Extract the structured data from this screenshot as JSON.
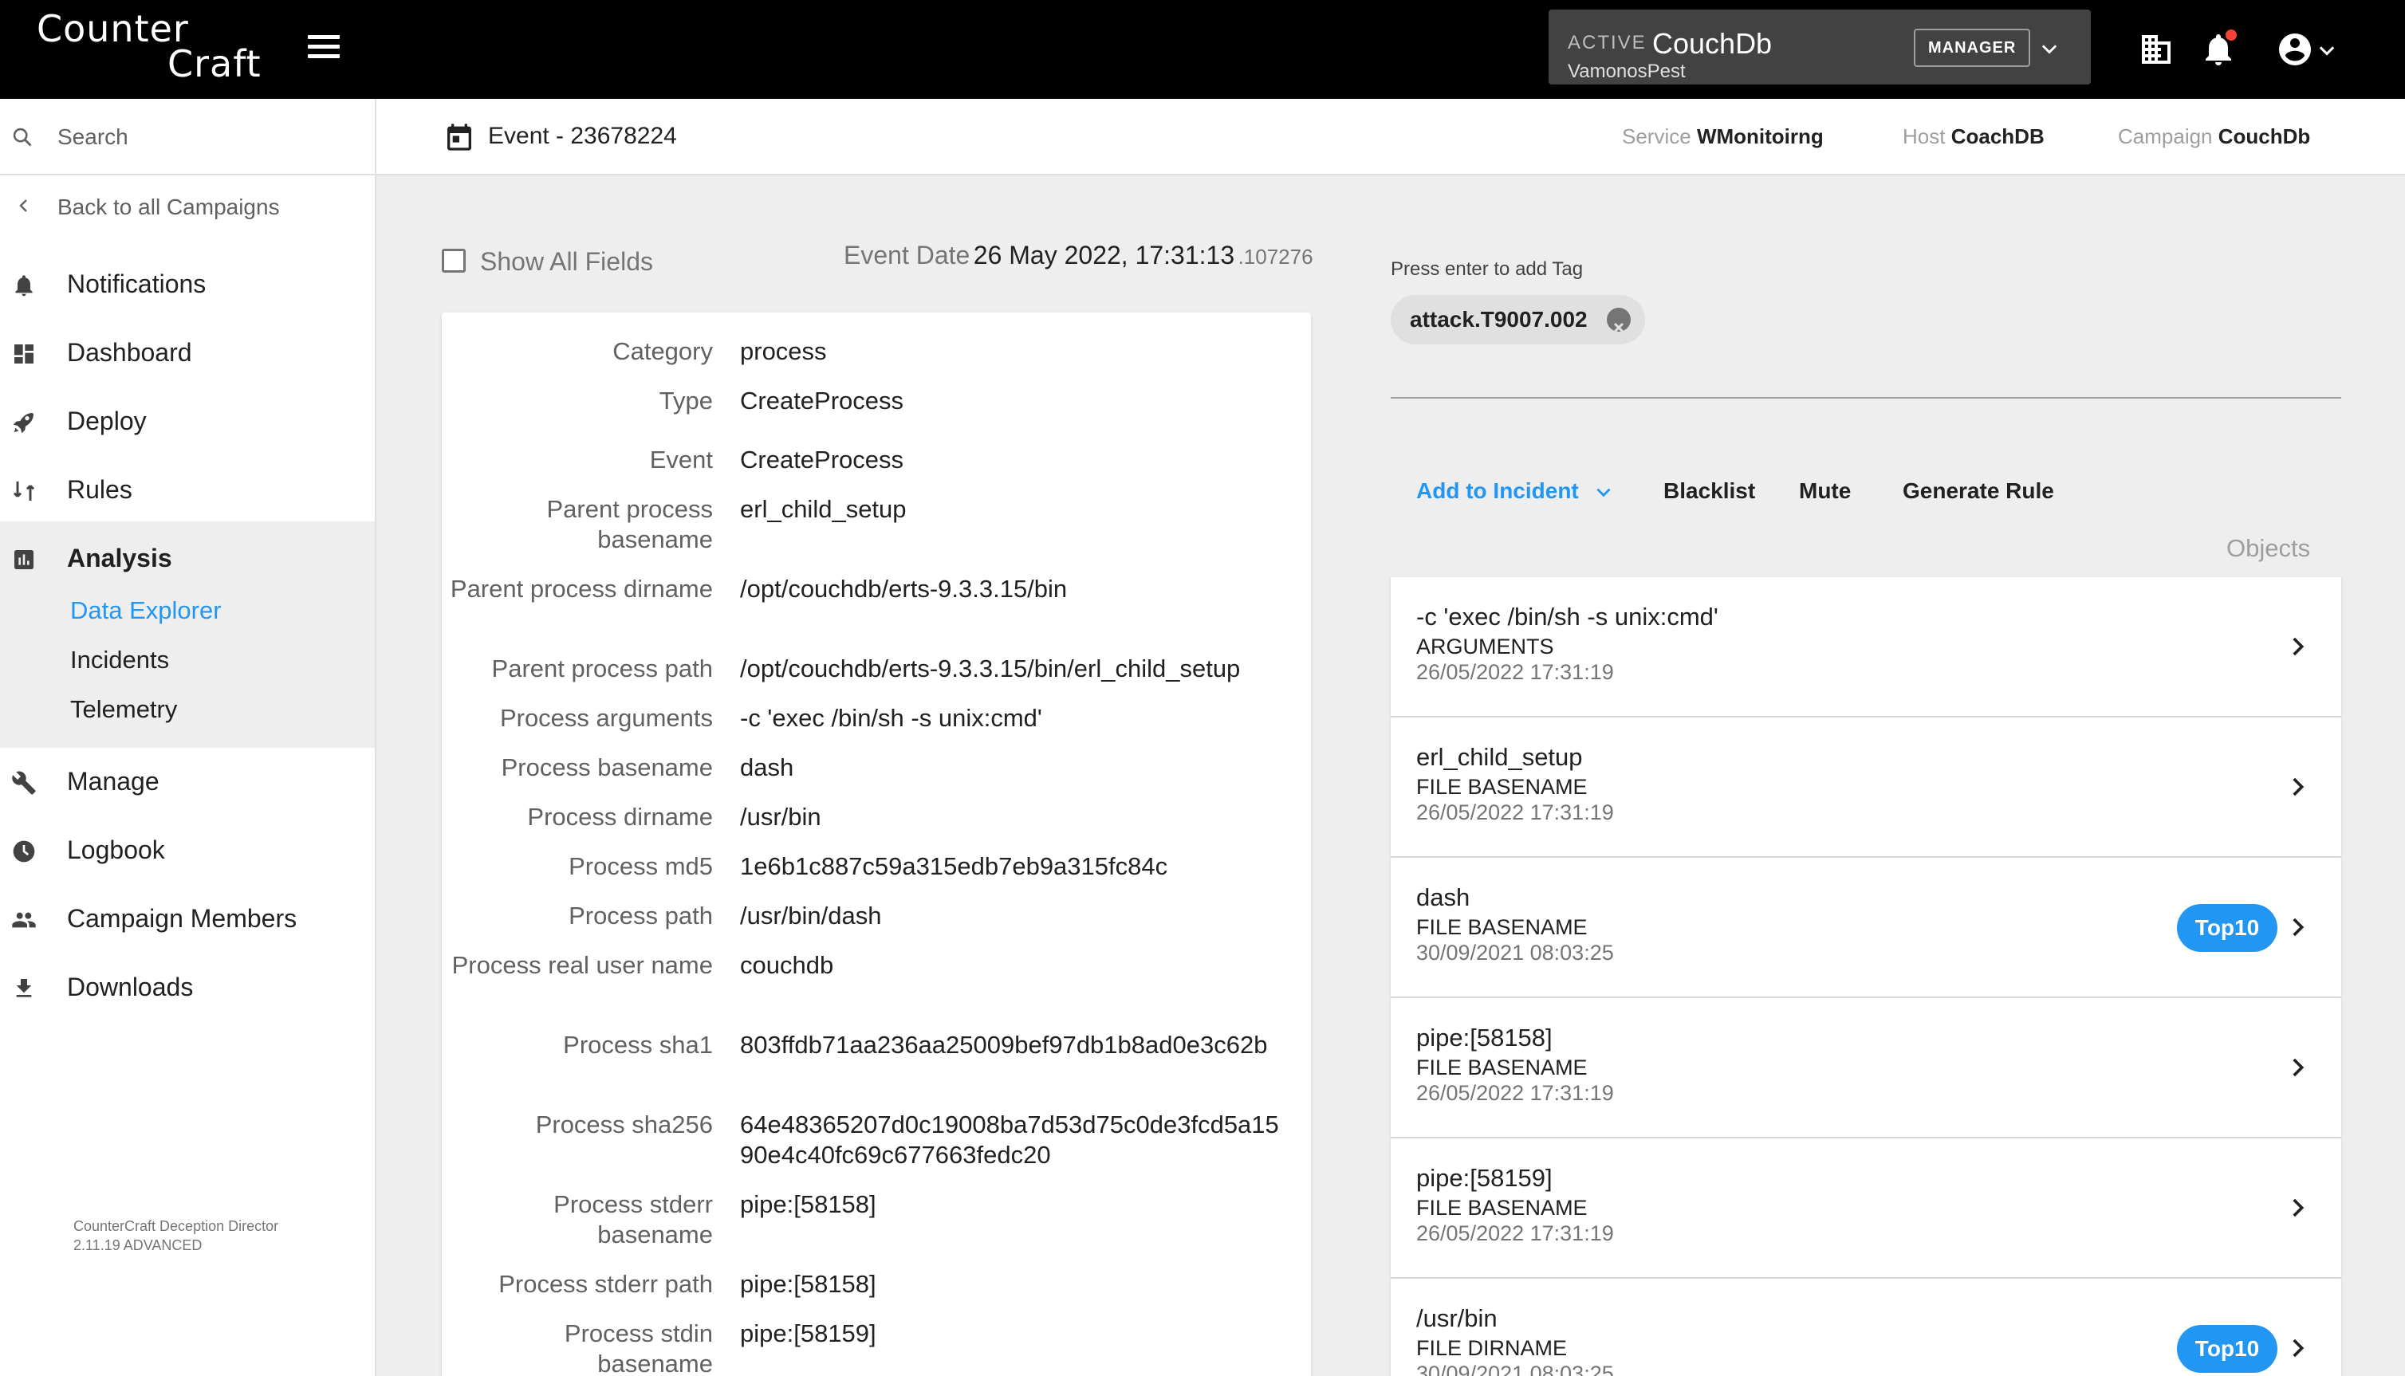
{
  "brand": {
    "line1": "Counter",
    "line2": "Craft"
  },
  "campaign_selector": {
    "status": "ACTIVE",
    "name": "CouchDb",
    "subtitle": "VamonosPest",
    "role": "MANAGER"
  },
  "sidebar": {
    "search_placeholder": "Search",
    "back_label": "Back to all Campaigns",
    "items": [
      {
        "label": "Notifications",
        "icon": "bell-icon"
      },
      {
        "label": "Dashboard",
        "icon": "dashboard-icon"
      },
      {
        "label": "Deploy",
        "icon": "rocket-icon"
      },
      {
        "label": "Rules",
        "icon": "rules-icon"
      },
      {
        "label": "Analysis",
        "icon": "analysis-icon"
      },
      {
        "label": "Manage",
        "icon": "wrench-icon"
      },
      {
        "label": "Logbook",
        "icon": "clock-icon"
      },
      {
        "label": "Campaign Members",
        "icon": "people-icon"
      },
      {
        "label": "Downloads",
        "icon": "download-icon"
      }
    ],
    "analysis_sub": [
      "Data Explorer",
      "Incidents",
      "Telemetry"
    ],
    "version_line1": "CounterCraft Deception Director",
    "version_line2": "2.11.19 ADVANCED"
  },
  "header": {
    "event_title": "Event - 23678224",
    "service_label": "Service",
    "service_value": "WMonitoirng",
    "host_label": "Host",
    "host_value": "CoachDB",
    "campaign_label": "Campaign",
    "campaign_value": "CouchDb"
  },
  "event": {
    "show_all_label": "Show All Fields",
    "date_label": "Event Date",
    "date_value": "26 May 2022, 17:31:13",
    "date_ms": ".107276",
    "fields": [
      {
        "k": "Category",
        "v": "process"
      },
      {
        "k": "Type",
        "v": "CreateProcess"
      },
      {
        "k": "Event",
        "v": "CreateProcess"
      },
      {
        "k": "Parent process basename",
        "v": "erl_child_setup"
      },
      {
        "k": "Parent process dirname",
        "v": "/opt/couchdb/erts-9.3.3.15/bin"
      },
      {
        "k": "Parent process path",
        "v": "/opt/couchdb/erts-9.3.3.15/bin/erl_child_setup"
      },
      {
        "k": "Process arguments",
        "v": "-c 'exec /bin/sh -s unix:cmd'"
      },
      {
        "k": "Process basename",
        "v": "dash"
      },
      {
        "k": "Process dirname",
        "v": "/usr/bin"
      },
      {
        "k": "Process md5",
        "v": "1e6b1c887c59a315edb7eb9a315fc84c"
      },
      {
        "k": "Process path",
        "v": "/usr/bin/dash"
      },
      {
        "k": "Process real user name",
        "v": "couchdb"
      },
      {
        "k": "Process sha1",
        "v": "803ffdb71aa236aa25009bef97db1b8ad0e3c62b"
      },
      {
        "k": "Process sha256",
        "v": "64e48365207d0c19008ba7d53d75c0de3fcd5a1590e4c40fc69c677663fedc20"
      },
      {
        "k": "Process stderr basename",
        "v": "pipe:[58158]"
      },
      {
        "k": "Process stderr path",
        "v": "pipe:[58158]"
      },
      {
        "k": "Process stdin basename",
        "v": "pipe:[58159]"
      }
    ]
  },
  "tags": {
    "hint": "Press enter to add Tag",
    "items": [
      "attack.T9007.002"
    ]
  },
  "actions": {
    "add_to_incident": "Add to Incident",
    "blacklist": "Blacklist",
    "mute": "Mute",
    "generate_rule": "Generate Rule"
  },
  "objects": {
    "title": "Objects",
    "items": [
      {
        "value": "-c 'exec /bin/sh -s unix:cmd'",
        "type": "ARGUMENTS",
        "date": "26/05/2022 17:31:19",
        "badge": ""
      },
      {
        "value": "erl_child_setup",
        "type": "FILE BASENAME",
        "date": "26/05/2022 17:31:19",
        "badge": ""
      },
      {
        "value": "dash",
        "type": "FILE BASENAME",
        "date": "30/09/2021 08:03:25",
        "badge": "Top10"
      },
      {
        "value": "pipe:[58158]",
        "type": "FILE BASENAME",
        "date": "26/05/2022 17:31:19",
        "badge": ""
      },
      {
        "value": "pipe:[58159]",
        "type": "FILE BASENAME",
        "date": "26/05/2022 17:31:19",
        "badge": ""
      },
      {
        "value": "/usr/bin",
        "type": "FILE DIRNAME",
        "date": "30/09/2021 08:03:25",
        "badge": "Top10"
      }
    ]
  },
  "colors": {
    "accent": "#2196f3",
    "topbar": "#000000",
    "notification_dot": "#f44336"
  }
}
